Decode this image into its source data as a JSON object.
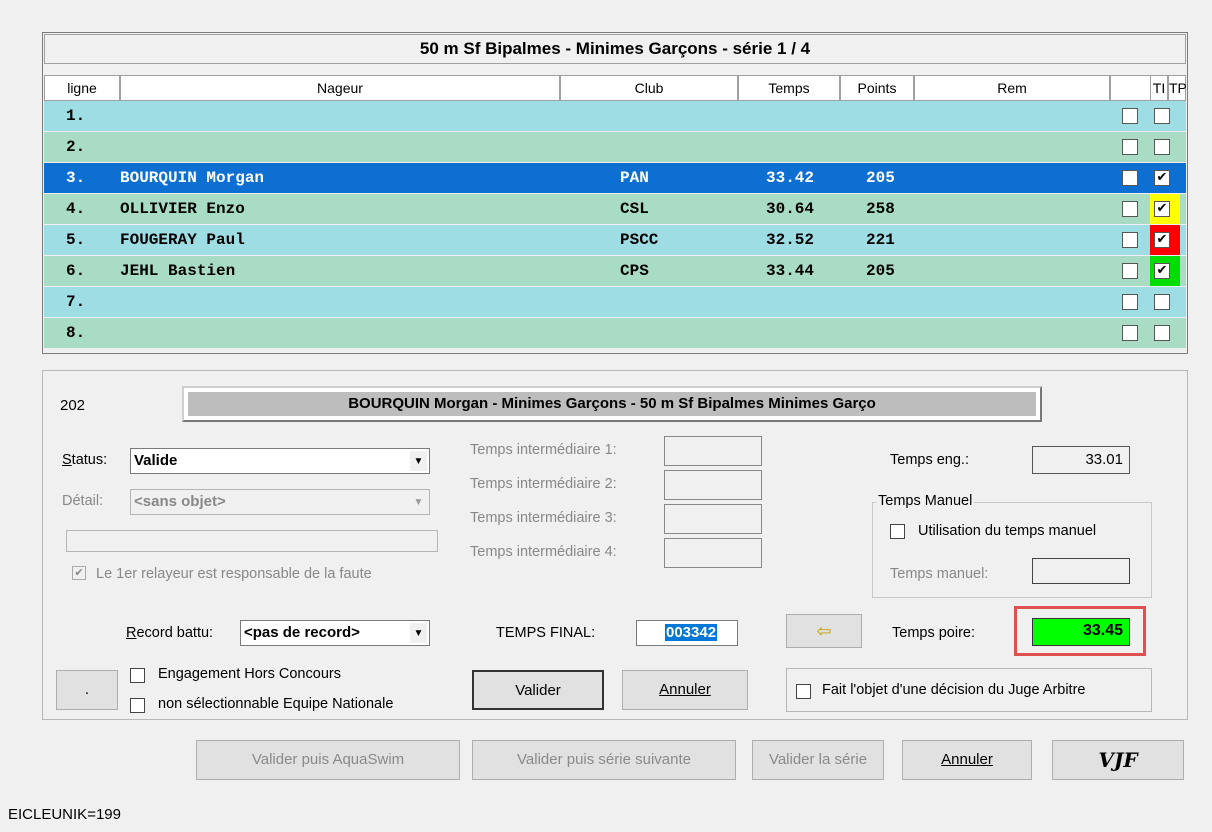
{
  "grid": {
    "title": "50 m Sf Bipalmes  -  Minimes Garçons  -  série 1 / 4",
    "headers": {
      "ligne": "ligne",
      "nageur": "Nageur",
      "club": "Club",
      "temps": "Temps",
      "points": "Points",
      "rem": "Rem",
      "ti": "TI",
      "tp": "TP"
    },
    "rows": [
      {
        "ligne": "1.",
        "nageur": "",
        "club": "",
        "temps": "",
        "points": "",
        "ti": "",
        "tp": ""
      },
      {
        "ligne": "2.",
        "nageur": "",
        "club": "",
        "temps": "",
        "points": "",
        "ti": "",
        "tp": ""
      },
      {
        "ligne": "3.",
        "nageur": "BOURQUIN Morgan",
        "club": "PAN",
        "temps": "33.42",
        "points": "205",
        "ti": "",
        "tp": "✔"
      },
      {
        "ligne": "4.",
        "nageur": "OLLIVIER Enzo",
        "club": "CSL",
        "temps": "30.64",
        "points": "258",
        "ti": "",
        "tp": "✔"
      },
      {
        "ligne": "5.",
        "nageur": "FOUGERAY Paul",
        "club": "PSCC",
        "temps": "32.52",
        "points": "221",
        "ti": "",
        "tp": "✔"
      },
      {
        "ligne": "6.",
        "nageur": "JEHL Bastien",
        "club": "CPS",
        "temps": "33.44",
        "points": "205",
        "ti": "",
        "tp": "✔"
      },
      {
        "ligne": "7.",
        "nageur": "",
        "club": "",
        "temps": "",
        "points": "",
        "ti": "",
        "tp": ""
      },
      {
        "ligne": "8.",
        "nageur": "",
        "club": "",
        "temps": "",
        "points": "",
        "ti": "",
        "tp": ""
      }
    ]
  },
  "detail": {
    "id": "202",
    "banner": "BOURQUIN Morgan  -  Minimes Garçons  -  50 m Sf Bipalmes Minimes Garço",
    "status_label": "Status:",
    "status_value": "Valide",
    "detail_label": "Détail:",
    "detail_value": "<sans objet>",
    "relayeur_label": "Le 1er relayeur est responsable de la faute",
    "relayeur_check": "✔",
    "ti1": "Temps intermédiaire 1:",
    "ti2": "Temps intermédiaire 2:",
    "ti3": "Temps intermédiaire 3:",
    "ti4": "Temps intermédiaire 4:",
    "temps_eng_label": "Temps eng.:",
    "temps_eng_value": "33.01",
    "temps_manuel_group": "Temps Manuel",
    "utilisation_label": "Utilisation du temps manuel",
    "temps_manuel_label": "Temps manuel:",
    "record_label": "Record battu:",
    "record_value": "<pas de record>",
    "temps_final_label": "TEMPS FINAL:",
    "temps_final_value": "003342",
    "arrow_glyph": "⇦",
    "temps_poire_label": "Temps poire:",
    "temps_poire_value": "33.45",
    "engagement_label": "Engagement Hors Concours",
    "non_selectionnable_label": "non sélectionnable Equipe Nationale",
    "dot_button": ".",
    "valider": "Valider",
    "annuler": "Annuler",
    "juge_label": "Fait l'objet d'une décision du Juge Arbitre"
  },
  "footer": {
    "valider_aquaswim": "Valider puis AquaSwim",
    "valider_serie_suivante": "Valider puis série suivante",
    "valider_serie": "Valider la série",
    "annuler": "Annuler",
    "logo": "VJF"
  },
  "status_bar": "EICLEUNIK=199",
  "colors": {
    "row_blue": "#9edde3",
    "row_green": "#a8dcc4",
    "selected": "#0c6fd1",
    "poire_green": "#00ff00",
    "highlight_red": "#e05050"
  }
}
